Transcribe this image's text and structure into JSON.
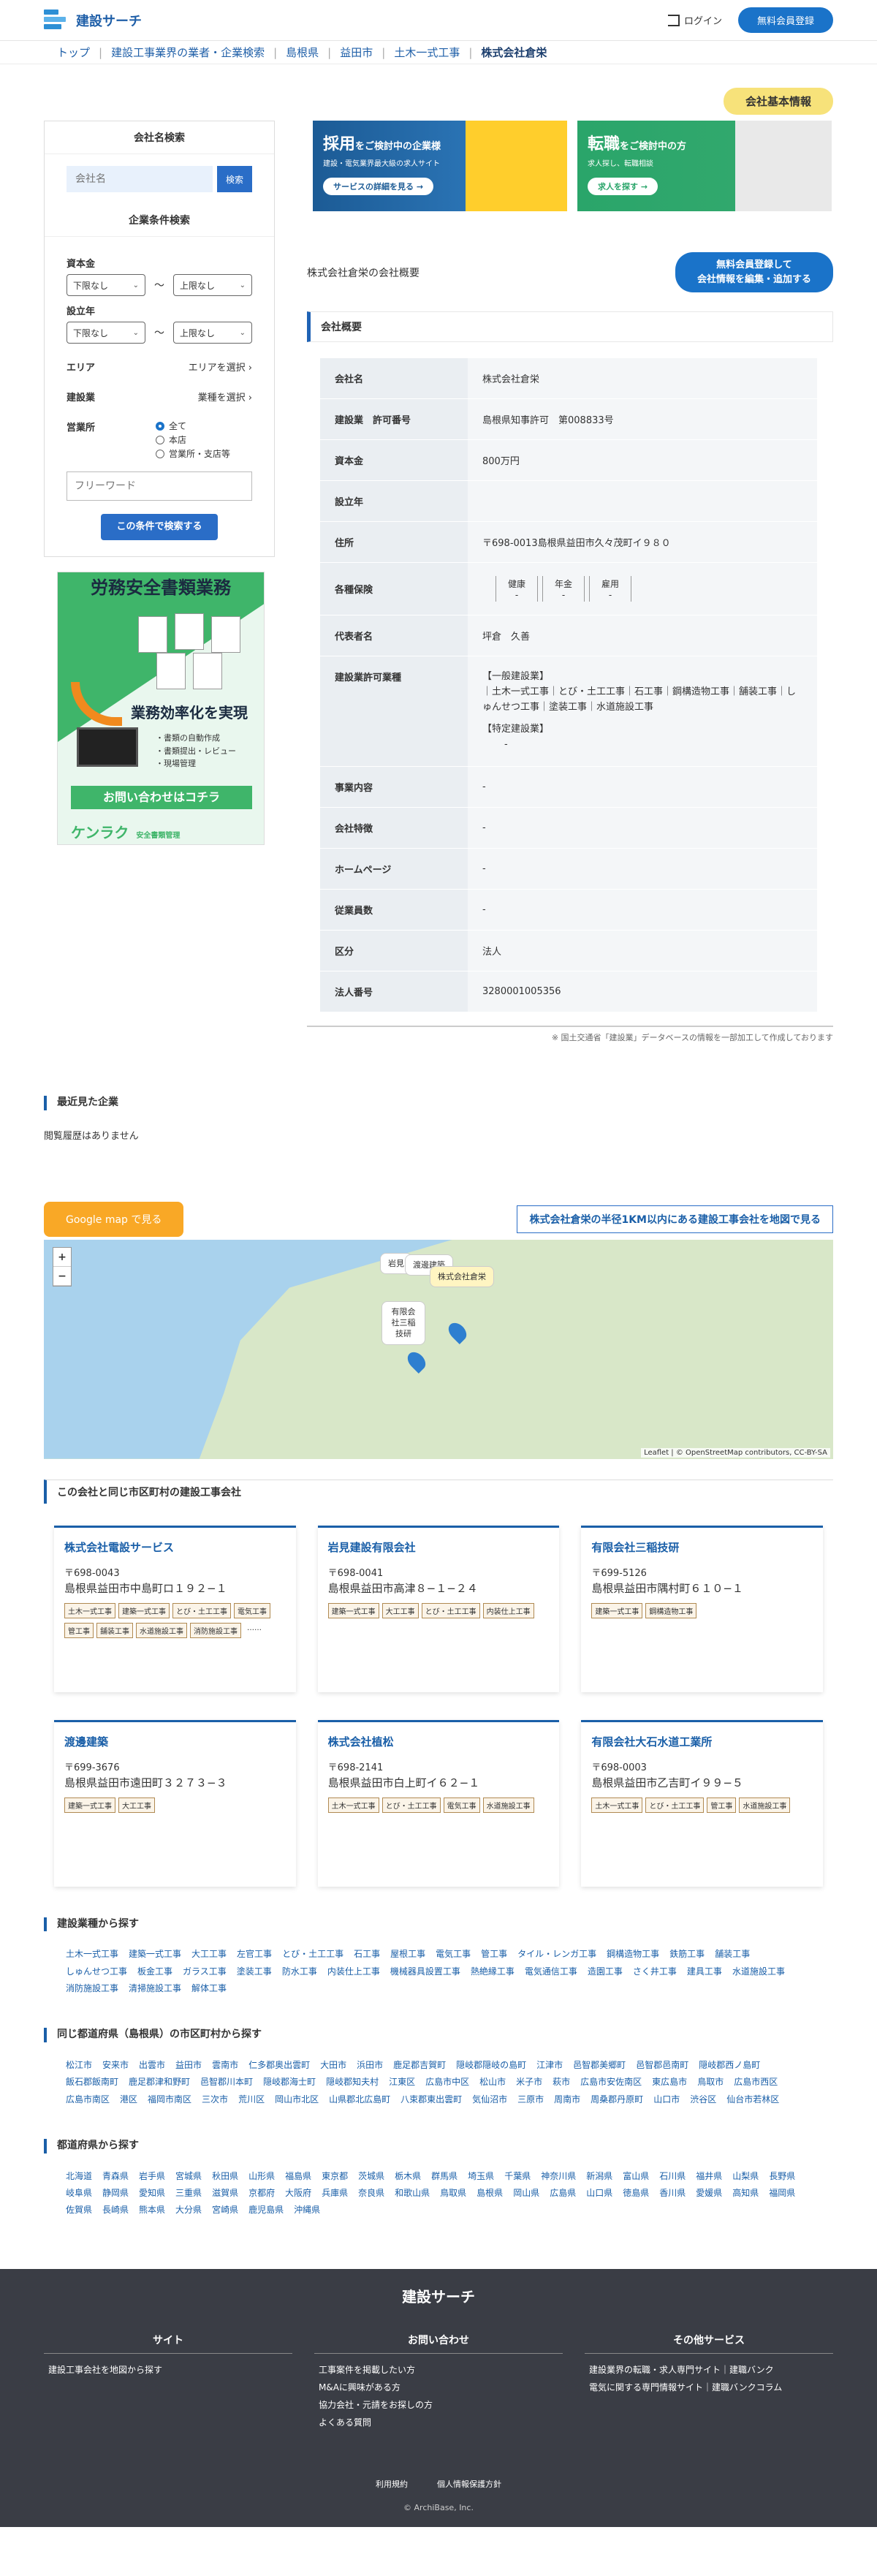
{
  "header": {
    "logo": "建設サーチ",
    "login": "ログイン",
    "register": "無料会員登録"
  },
  "breadcrumb": [
    "トップ",
    "建設工事業界の業者・企業検索",
    "島根県",
    "益田市",
    "土木一式工事",
    "株式会社倉栄"
  ],
  "basic_info_tag": "会社基本情報",
  "sidebar": {
    "name_search_title": "会社名検索",
    "name_placeholder": "会社名",
    "search_btn": "検索",
    "cond_title": "企業条件検索",
    "capital_label": "資本金",
    "founded_label": "設立年",
    "select_lower": "下限なし",
    "select_upper": "上限なし",
    "tilde": "〜",
    "area_label": "エリア",
    "area_select": "エリアを選択",
    "industry_label": "建設業",
    "industry_select": "業種を選択",
    "office_label": "営業所",
    "radios": [
      "全て",
      "本店",
      "営業所・支店等"
    ],
    "free_placeholder": "フリーワード",
    "submit": "この条件で検索する"
  },
  "ad": {
    "title": "労務安全書類業務",
    "eff": "業務効率化を実現",
    "items": [
      "・書類の自動作成",
      "・書類提出・レビュー",
      "・現場管理"
    ],
    "cta": "お問い合わせはコチラ",
    "brand": "ケンラク",
    "brand_sub": "安全書類管理"
  },
  "banners": [
    {
      "title": "採用",
      "title_rest": "をご検討中の企業様",
      "sub": "建設・電気業界最大級の求人サイト",
      "btn": "サービスの詳細を見る →"
    },
    {
      "title": "転職",
      "title_rest": "をご検討中の方",
      "sub": "求人探し、転職相談",
      "btn": "求人を探す →"
    }
  ],
  "overview_title": "株式会社倉栄の会社概要",
  "overview_btn_1": "無料会員登録して",
  "overview_btn_2": "会社情報を編集・追加する",
  "section_title": "会社概要",
  "rows": [
    {
      "k": "会社名",
      "v": "株式会社倉栄"
    },
    {
      "k": "建設業　許可番号",
      "v": "島根県知事許可　第008833号"
    },
    {
      "k": "資本金",
      "v": "800万円"
    },
    {
      "k": "設立年",
      "v": ""
    },
    {
      "k": "住所",
      "v": "〒698-0013島根県益田市久々茂町イ９８０"
    }
  ],
  "insurance": {
    "k": "各種保険",
    "items": [
      {
        "n": "健康",
        "v": "-"
      },
      {
        "n": "年金",
        "v": "-"
      },
      {
        "n": "雇用",
        "v": "-"
      }
    ]
  },
  "rep": {
    "k": "代表者名",
    "v": "坪倉　久善"
  },
  "permit": {
    "k": "建設業許可業種",
    "g1": "【一般建設業】",
    "g1v": "｜土木一式工事｜とび・土工工事｜石工事｜鋼構造物工事｜舗装工事｜しゅんせつ工事｜塗装工事｜水道施設工事",
    "g2": "【特定建設業】",
    "g2v": "-"
  },
  "rows2": [
    {
      "k": "事業内容",
      "v": "-"
    },
    {
      "k": "会社特徴",
      "v": "-"
    },
    {
      "k": "ホームページ",
      "v": "-"
    },
    {
      "k": "従業員数",
      "v": "-"
    },
    {
      "k": "区分",
      "v": "法人"
    },
    {
      "k": "法人番号",
      "v": "3280001005356"
    }
  ],
  "note": "※ 国土交通省「建設業」データベースの情報を一部加工して作成しております",
  "recent": {
    "title": "最近見た企業",
    "empty": "閲覧履歴はありません"
  },
  "map": {
    "gmap_btn": "Google map で見る",
    "link": "株式会社倉栄の半径1KM以内にある建設工事会社を地図で見る",
    "popup1": "渡邊建築",
    "popup2": "株式会社倉栄",
    "popup3": "有限会社三稲技研",
    "popup4": "岩見",
    "attribution": "Leaflet | © OpenStreetMap contributors, CC-BY-SA"
  },
  "same_title": "この会社と同じ市区町村の建設工事会社",
  "cards": [
    {
      "name": "株式会社電設サービス",
      "zip": "〒698-0043",
      "addr": "島根県益田市中島町ロ１９２−１",
      "tags": [
        "土木一式工事",
        "建築一式工事",
        "とび・土工工事",
        "電気工事",
        "管工事",
        "舗装工事",
        "水道施設工事",
        "消防施設工事"
      ],
      "more": "……"
    },
    {
      "name": "岩見建設有限会社",
      "zip": "〒698-0041",
      "addr": "島根県益田市高津８−１−２４",
      "tags": [
        "建築一式工事",
        "大工工事",
        "とび・土工工事",
        "内装仕上工事"
      ],
      "more": ""
    },
    {
      "name": "有限会社三稲技研",
      "zip": "〒699-5126",
      "addr": "島根県益田市隅村町６１０−１",
      "tags": [
        "建築一式工事",
        "鋼構造物工事"
      ],
      "more": ""
    },
    {
      "name": "渡邊建築",
      "zip": "〒699-3676",
      "addr": "島根県益田市遠田町３２７３−３",
      "tags": [
        "建築一式工事",
        "大工工事"
      ],
      "more": ""
    },
    {
      "name": "株式会社植松",
      "zip": "〒698-2141",
      "addr": "島根県益田市白上町イ６２−１",
      "tags": [
        "土木一式工事",
        "とび・土工工事",
        "電気工事",
        "水道施設工事"
      ],
      "more": ""
    },
    {
      "name": "有限会社大石水道工業所",
      "zip": "〒698-0003",
      "addr": "島根県益田市乙吉町イ９９−５",
      "tags": [
        "土木一式工事",
        "とび・土工工事",
        "管工事",
        "水道施設工事"
      ],
      "more": ""
    }
  ],
  "industry": {
    "title": "建設業種から探す",
    "items": [
      "土木一式工事",
      "建築一式工事",
      "大工工事",
      "左官工事",
      "とび・土工工事",
      "石工事",
      "屋根工事",
      "電気工事",
      "管工事",
      "タイル・レンガ工事",
      "鋼構造物工事",
      "鉄筋工事",
      "舗装工事",
      "しゅんせつ工事",
      "板金工事",
      "ガラス工事",
      "塗装工事",
      "防水工事",
      "内装仕上工事",
      "機械器具設置工事",
      "熱絶縁工事",
      "電気通信工事",
      "造園工事",
      "さく井工事",
      "建具工事",
      "水道施設工事",
      "消防施設工事",
      "清掃施設工事",
      "解体工事"
    ]
  },
  "city": {
    "title": "同じ都道府県（島根県）の市区町村から探す",
    "items": [
      "松江市",
      "安来市",
      "出雲市",
      "益田市",
      "雲南市",
      "仁多郡奥出雲町",
      "大田市",
      "浜田市",
      "鹿足郡吉賀町",
      "隠岐郡隠岐の島町",
      "江津市",
      "邑智郡美郷町",
      "邑智郡邑南町",
      "隠岐郡西ノ島町",
      "飯石郡飯南町",
      "鹿足郡津和野町",
      "邑智郡川本町",
      "隠岐郡海士町",
      "隠岐郡知夫村",
      "江東区",
      "広島市中区",
      "松山市",
      "米子市",
      "萩市",
      "広島市安佐南区",
      "東広島市",
      "鳥取市",
      "広島市西区",
      "広島市南区",
      "港区",
      "福岡市南区",
      "三次市",
      "荒川区",
      "岡山市北区",
      "山県郡北広島町",
      "八束郡東出雲町",
      "気仙沼市",
      "三原市",
      "周南市",
      "周桑郡丹原町",
      "山口市",
      "渋谷区",
      "仙台市若林区"
    ]
  },
  "pref": {
    "title": "都道府県から探す",
    "items": [
      "北海道",
      "青森県",
      "岩手県",
      "宮城県",
      "秋田県",
      "山形県",
      "福島県",
      "東京都",
      "茨城県",
      "栃木県",
      "群馬県",
      "埼玉県",
      "千葉県",
      "神奈川県",
      "新潟県",
      "富山県",
      "石川県",
      "福井県",
      "山梨県",
      "長野県",
      "岐阜県",
      "静岡県",
      "愛知県",
      "三重県",
      "滋賀県",
      "京都府",
      "大阪府",
      "兵庫県",
      "奈良県",
      "和歌山県",
      "鳥取県",
      "島根県",
      "岡山県",
      "広島県",
      "山口県",
      "徳島県",
      "香川県",
      "愛媛県",
      "高知県",
      "福岡県",
      "佐賀県",
      "長崎県",
      "熊本県",
      "大分県",
      "宮崎県",
      "鹿児島県",
      "沖縄県"
    ]
  },
  "footer": {
    "logo": "建設サーチ",
    "c1": "サイト",
    "c1i": [
      "建設工事会社を地図から探す"
    ],
    "c2": "お問い合わせ",
    "c2i": [
      "工事案件を掲載したい方",
      "M&Aに興味がある方",
      "協力会社・元請をお探しの方",
      "よくある質問"
    ],
    "c3": "その他サービス",
    "c3i": [
      "建設業界の転職・求人専門サイト｜建職バンク",
      "電気に関する専門情報サイト｜建職バンクコラム"
    ],
    "terms": "利用規約",
    "privacy": "個人情報保護方針",
    "copy": "© ArchiBase, Inc."
  }
}
